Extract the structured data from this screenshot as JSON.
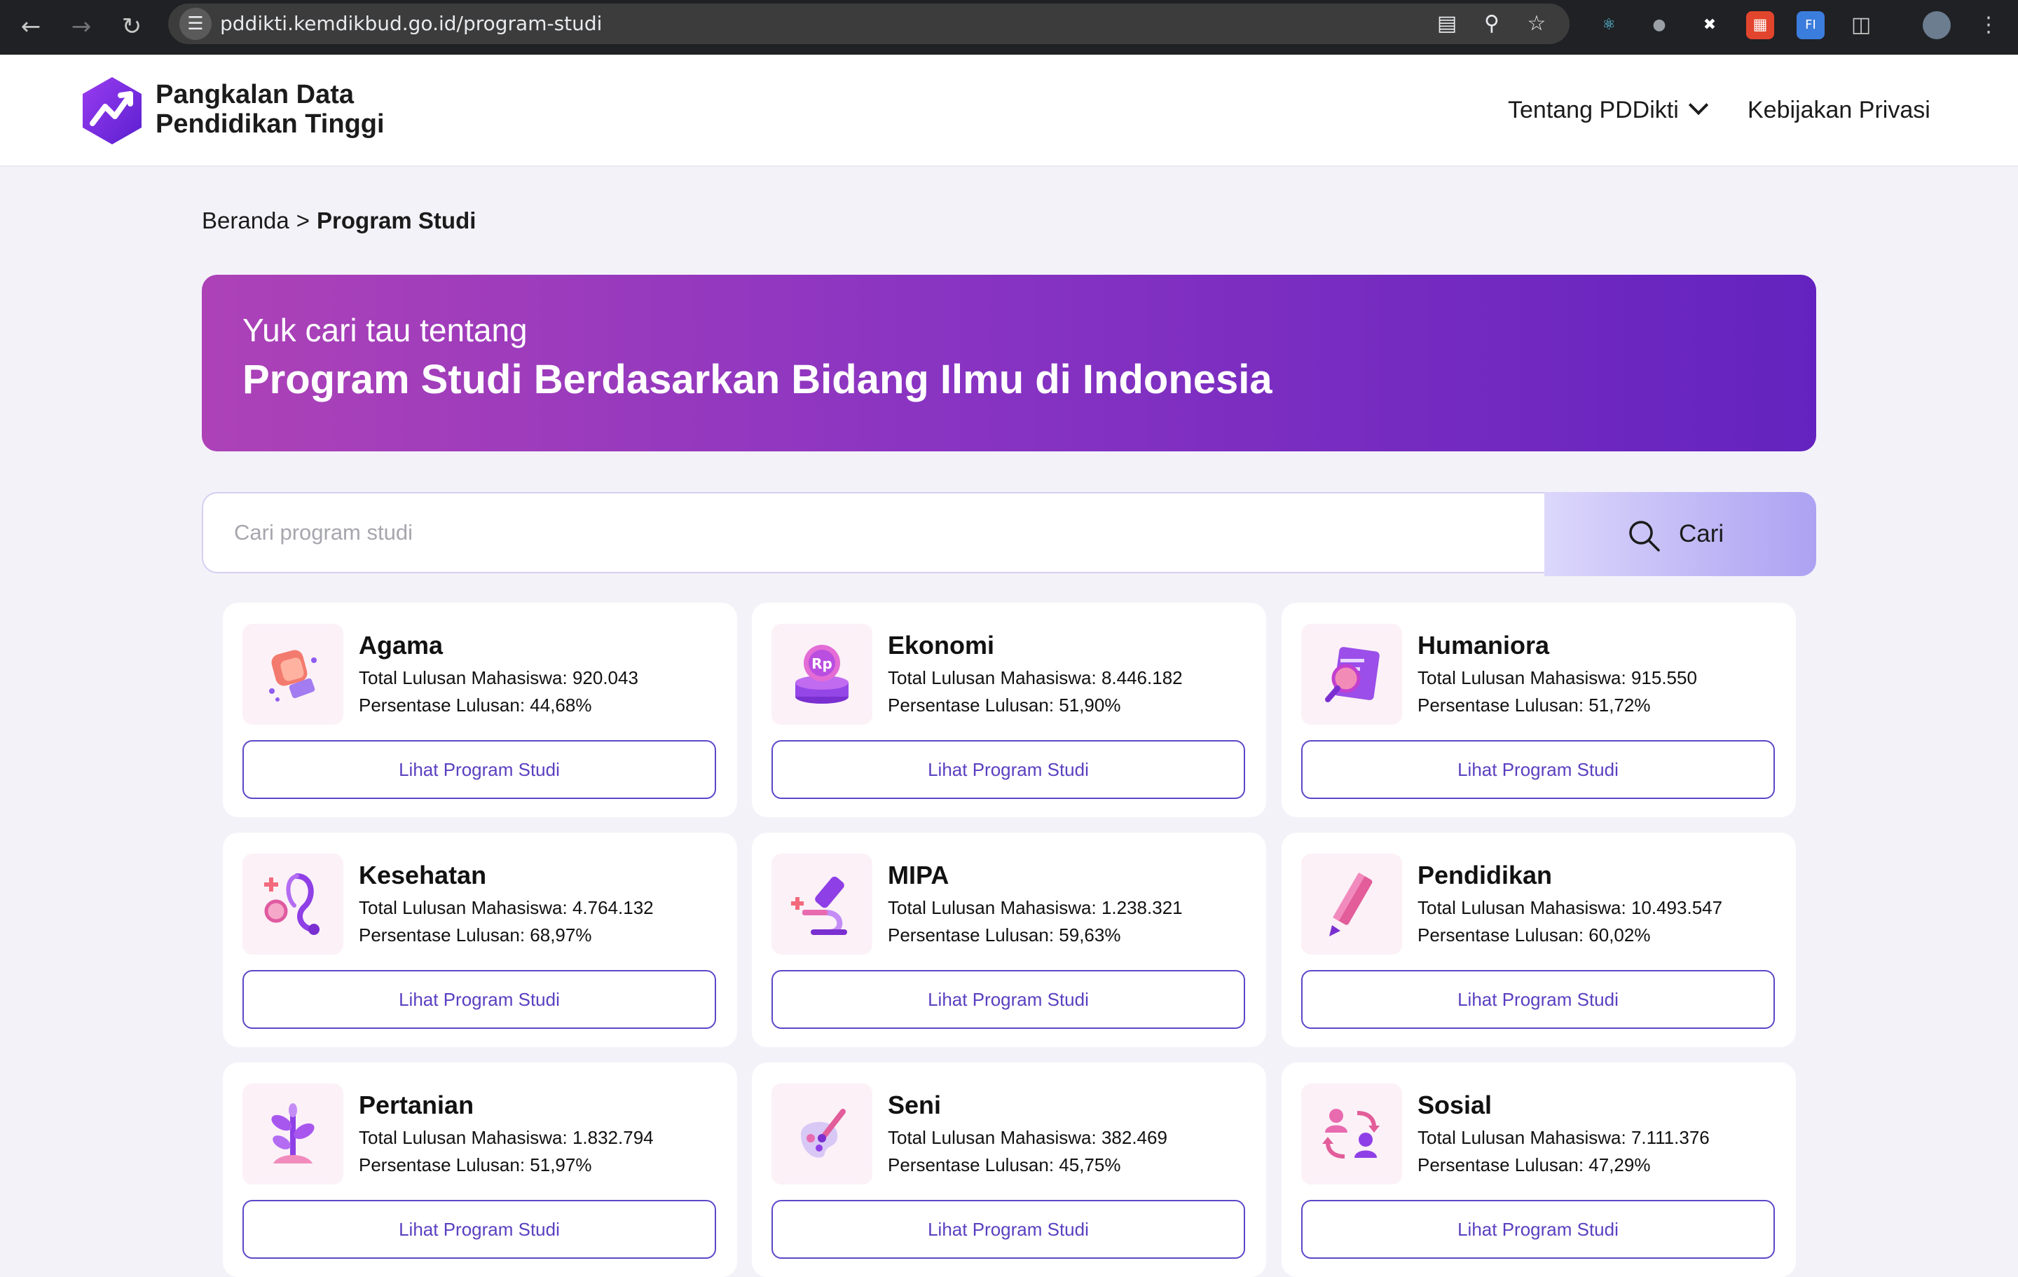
{
  "browser": {
    "url": "pddikti.kemdikbud.go.id/program-studi"
  },
  "header": {
    "logo_line1": "Pangkalan Data",
    "logo_line2": "Pendidikan Tinggi",
    "nav": {
      "about": "Tentang PDDikti",
      "privacy": "Kebijakan Privasi"
    }
  },
  "breadcrumb": {
    "home": "Beranda",
    "separator": ">",
    "current": "Program Studi"
  },
  "hero": {
    "subtitle": "Yuk cari tau tentang",
    "title": "Program Studi Berdasarkan Bidang Ilmu di Indonesia"
  },
  "search": {
    "placeholder": "Cari program studi",
    "button": "Cari"
  },
  "cards": [
    {
      "title": "Agama",
      "total": "Total Lulusan Mahasiswa: 920.043",
      "percent": "Persentase Lulusan: 44,68%",
      "button": "Lihat Program Studi",
      "icon": "praying-hands-icon"
    },
    {
      "title": "Ekonomi",
      "total": "Total Lulusan Mahasiswa: 8.446.182",
      "percent": "Persentase Lulusan: 51,90%",
      "button": "Lihat Program Studi",
      "icon": "coin-rp-icon"
    },
    {
      "title": "Humaniora",
      "total": "Total Lulusan Mahasiswa: 915.550",
      "percent": "Persentase Lulusan: 51,72%",
      "button": "Lihat Program Studi",
      "icon": "document-search-icon"
    },
    {
      "title": "Kesehatan",
      "total": "Total Lulusan Mahasiswa: 4.764.132",
      "percent": "Persentase Lulusan: 68,97%",
      "button": "Lihat Program Studi",
      "icon": "stethoscope-icon"
    },
    {
      "title": "MIPA",
      "total": "Total Lulusan Mahasiswa: 1.238.321",
      "percent": "Persentase Lulusan: 59,63%",
      "button": "Lihat Program Studi",
      "icon": "microscope-icon"
    },
    {
      "title": "Pendidikan",
      "total": "Total Lulusan Mahasiswa: 10.493.547",
      "percent": "Persentase Lulusan: 60,02%",
      "button": "Lihat Program Studi",
      "icon": "pencil-icon"
    },
    {
      "title": "Pertanian",
      "total": "Total Lulusan Mahasiswa: 1.832.794",
      "percent": "Persentase Lulusan: 51,97%",
      "button": "Lihat Program Studi",
      "icon": "plant-icon"
    },
    {
      "title": "Seni",
      "total": "Total Lulusan Mahasiswa: 382.469",
      "percent": "Persentase Lulusan: 45,75%",
      "button": "Lihat Program Studi",
      "icon": "palette-icon"
    },
    {
      "title": "Sosial",
      "total": "Total Lulusan Mahasiswa: 7.111.376",
      "percent": "Persentase Lulusan: 47,29%",
      "button": "Lihat Program Studi",
      "icon": "people-exchange-icon"
    }
  ],
  "colors": {
    "brand": "#7b2fd1",
    "hero_start": "#ad42b7",
    "hero_end": "#6423bf",
    "button_text": "#5a3fc0"
  }
}
